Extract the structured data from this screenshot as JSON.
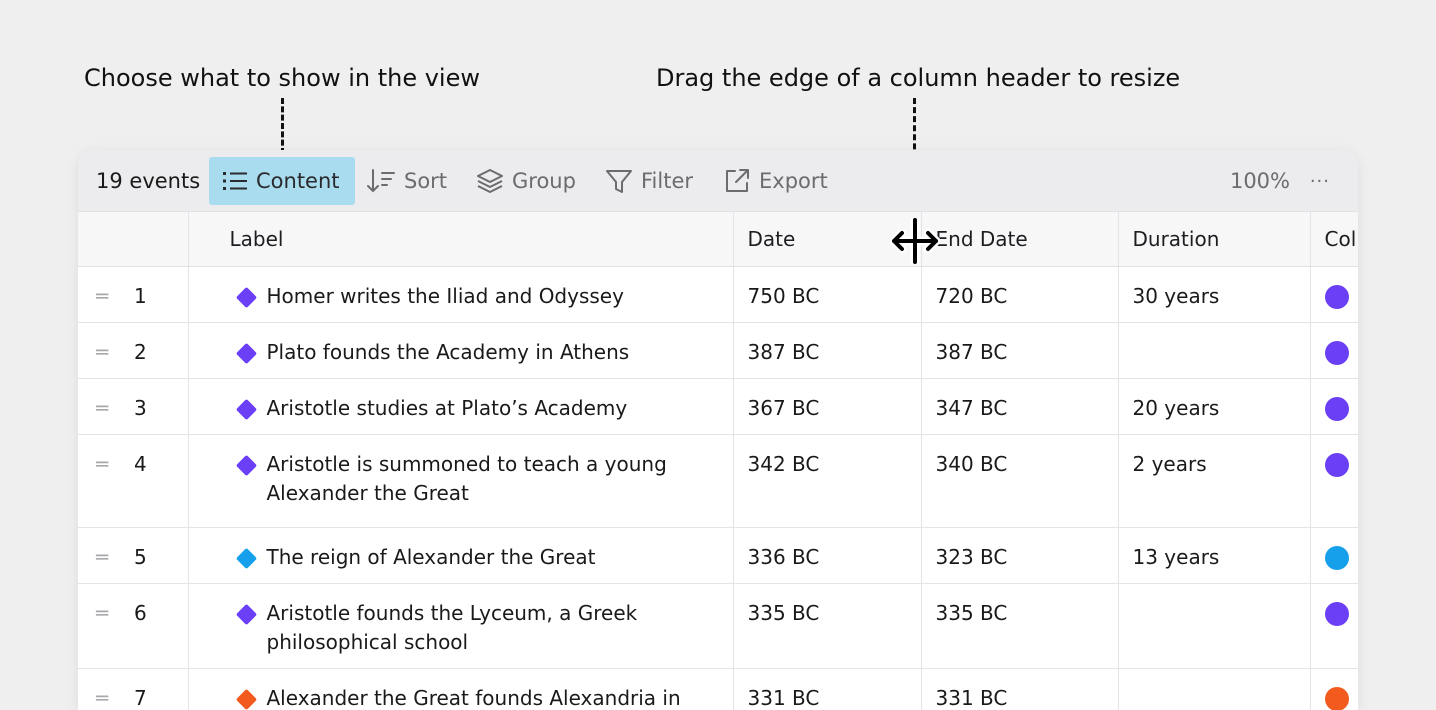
{
  "annotations": {
    "content_hint": "Choose what to show in the view",
    "resize_hint": "Drag the edge of a column header to resize"
  },
  "toolbar": {
    "event_count": "19 events",
    "content_label": "Content",
    "sort_label": "Sort",
    "group_label": "Group",
    "filter_label": "Filter",
    "export_label": "Export",
    "zoom": "100%",
    "more": "···"
  },
  "table": {
    "columns": [
      "",
      "Label",
      "Date",
      "End Date",
      "Duration",
      "Col"
    ],
    "rows": [
      {
        "num": "1",
        "label": "Homer writes the Iliad and Odyssey",
        "date": "750 BC",
        "end": "720 BC",
        "duration": "30 years",
        "color": "#6a3ff5"
      },
      {
        "num": "2",
        "label": "Plato founds the Academy in Athens",
        "date": "387 BC",
        "end": "387 BC",
        "duration": "",
        "color": "#6a3ff5"
      },
      {
        "num": "3",
        "label": "Aristotle studies at Plato’s Academy",
        "date": "367 BC",
        "end": "347 BC",
        "duration": "20 years",
        "color": "#6a3ff5"
      },
      {
        "num": "4",
        "label": "Aristotle is summoned to teach a young Alexander the Great",
        "date": "342 BC",
        "end": "340 BC",
        "duration": "2 years",
        "color": "#6a3ff5"
      },
      {
        "num": "5",
        "label": "The reign of Alexander the Great",
        "date": "336 BC",
        "end": "323 BC",
        "duration": "13 years",
        "color": "#16a0ec"
      },
      {
        "num": "6",
        "label": "Aristotle founds the Lyceum, a Greek philosophical school",
        "date": "335 BC",
        "end": "335 BC",
        "duration": "",
        "color": "#6a3ff5"
      },
      {
        "num": "7",
        "label": "Alexander the Great founds Alexandria in",
        "date": "331 BC",
        "end": "331 BC",
        "duration": "",
        "color": "#f25a1e"
      }
    ]
  },
  "icons": {
    "content": "list-icon",
    "sort": "sort-icon",
    "group": "layers-icon",
    "filter": "filter-icon",
    "export": "export-icon",
    "row_handle": "drag-handle-icon",
    "cursor": "resize-cursor-icon"
  }
}
